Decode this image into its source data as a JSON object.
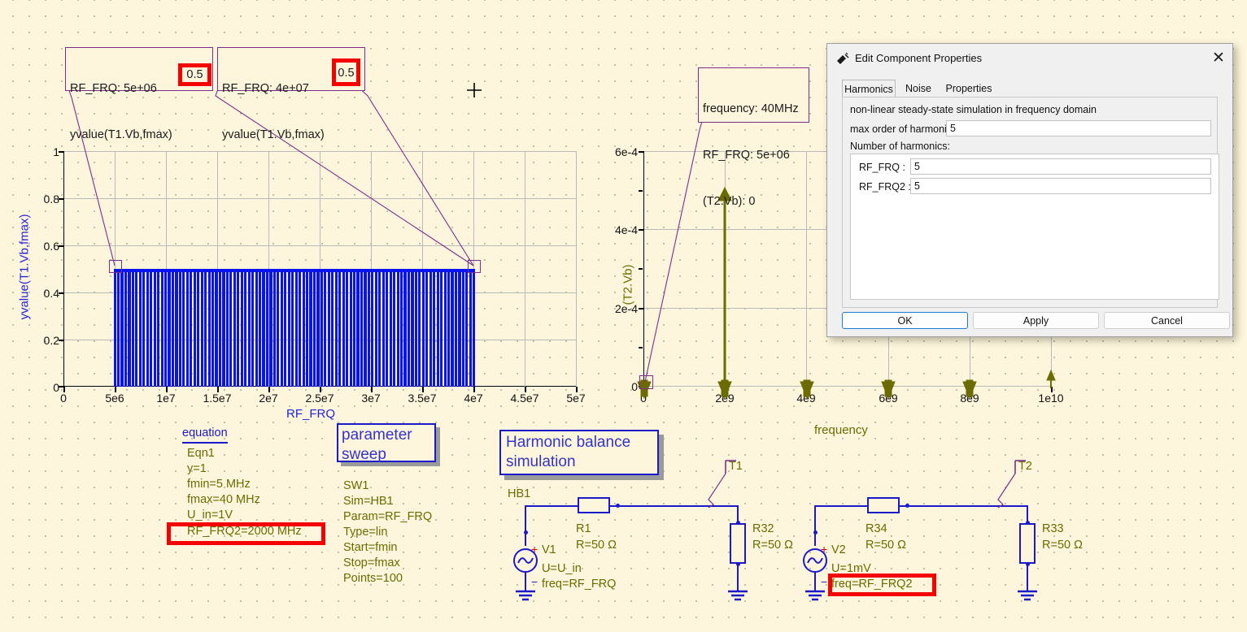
{
  "markers": {
    "left1": {
      "line1": "RF_FRQ: 5e+06",
      "line2": "yvalue(T1.Vb,fmax)",
      "value": "0.5"
    },
    "left2": {
      "line1": "RF_FRQ: 4e+07",
      "line2": "yvalue(T1.Vb,fmax)",
      "value": "0.5"
    },
    "right1": {
      "line1": "frequency: 40MHz",
      "line2": "RF_FRQ: 5e+06",
      "line3": "(T2.Vb): 0"
    }
  },
  "chart_data": [
    {
      "type": "bar",
      "title": "",
      "xlabel": "RF_FRQ",
      "ylabel": "yvalue(T1.Vb,fmax)",
      "xlim": [
        0,
        50000000
      ],
      "ylim": [
        0,
        1
      ],
      "xticks": [
        "0",
        "5e6",
        "1e7",
        "1.5e7",
        "2e7",
        "2.5e7",
        "3e7",
        "3.5e7",
        "4e7",
        "4.5e7",
        "5e7"
      ],
      "yticks": [
        "0",
        "0.2",
        "0.4",
        "0.6",
        "0.8",
        "1"
      ],
      "grid": true,
      "series_color": "#0713f0",
      "x_start": 5000000,
      "x_end": 40000000,
      "constant_value": 0.5,
      "n_points": 100
    },
    {
      "type": "bar",
      "title": "",
      "xlabel": "frequency",
      "ylabel": "(T2.Vb)",
      "xlim": [
        0,
        10000000000
      ],
      "ylim": [
        0,
        0.0006
      ],
      "xticks": [
        "0",
        "2e9",
        "4e9",
        "6e9",
        "8e9",
        "1e10"
      ],
      "yticks": [
        "0",
        "2e-4",
        "4e-4",
        "6e-4"
      ],
      "grid": true,
      "series_color": "#6b6b00",
      "x": [
        0,
        2000000000,
        4000000000,
        6000000000,
        8000000000,
        10000000000
      ],
      "values": [
        5e-07,
        0.000525,
        5e-07,
        5e-07,
        5e-07,
        1.2e-05
      ]
    }
  ],
  "equation_block": {
    "title": "equation",
    "lines": [
      "Eqn1",
      "y=1",
      "fmin=5 MHz",
      "fmax=40 MHz",
      "U_in=1V"
    ],
    "highlighted": "RF_FRQ2=2000 MHz"
  },
  "sweep_block": {
    "title": "parameter\nsweep",
    "lines": [
      "SW1",
      "Sim=HB1",
      "Param=RF_FRQ",
      "Type=lin",
      "Start=fmin",
      "Stop=fmax",
      "Points=100"
    ]
  },
  "hb_block": {
    "title": "Harmonic balance\nsimulation",
    "name": "HB1"
  },
  "schematic": {
    "probe1": "T1",
    "probe2": "T2",
    "v1": {
      "name": "V1",
      "u": "U=U_in",
      "freq": "freq=RF_FRQ",
      "plus": "+",
      "minus": "−"
    },
    "v2": {
      "name": "V2",
      "u": "U=1mV",
      "freq": "freq=RF_FRQ2",
      "plus": "+",
      "minus": "−"
    },
    "r1": {
      "name": "R1",
      "value": "R=50 Ω"
    },
    "r32": {
      "name": "R32",
      "value": "R=50 Ω"
    },
    "r34": {
      "name": "R34",
      "value": "R=50 Ω"
    },
    "r33": {
      "name": "R33",
      "value": "R=50 Ω"
    }
  },
  "dialog": {
    "title": "Edit Component Properties",
    "close_label": "✕",
    "tabs": [
      {
        "label": "Harmonics",
        "active": true
      },
      {
        "label": "Noise",
        "active": false
      },
      {
        "label": "Properties",
        "active": false
      }
    ],
    "description": "non-linear steady-state simulation in frequency domain",
    "max_order_label": "max order of harmonics:",
    "max_order_value": "5",
    "number_of_harmonics_label": "Number of harmonics:",
    "harmonics": [
      {
        "label": "RF_FRQ :",
        "value": "5"
      },
      {
        "label": "RF_FRQ2 :",
        "value": "5"
      }
    ],
    "buttons": {
      "ok": "OK",
      "apply": "Apply",
      "cancel": "Cancel"
    }
  },
  "colors": {
    "background": "#fdf6dc",
    "bar_blue": "#0713f0",
    "olive": "#6b6b00",
    "marker_purple": "#7b2d8e",
    "highlight_red": "#f50000",
    "schematic_blue": "#1a1acc"
  }
}
